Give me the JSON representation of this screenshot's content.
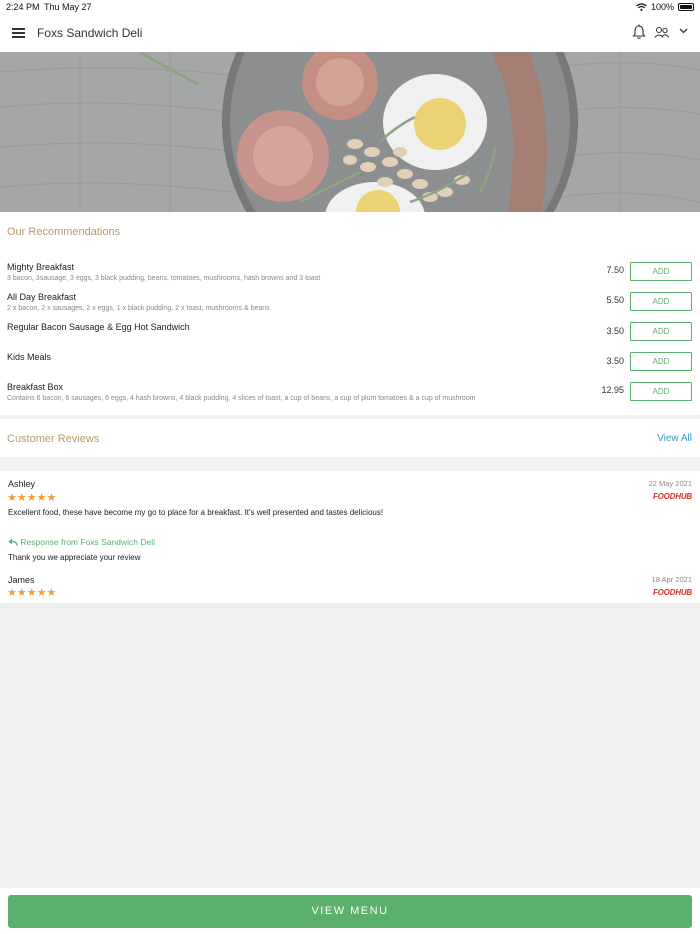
{
  "status_bar": {
    "time": "2:24 PM",
    "date": "Thu May 27",
    "battery": "100%"
  },
  "header": {
    "title": "Foxs Sandwich Deli"
  },
  "recommendations": {
    "title": "Our Recommendations",
    "add_label": "ADD",
    "items": [
      {
        "name": "Mighty Breakfast",
        "desc": "3 bacon, 3sausage, 3 eggs, 3 black pudding, beans, tomatoes, mushrooms, hash browns and 3 toast",
        "price": "7.50"
      },
      {
        "name": "All Day Breakfast",
        "desc": "2 x bacon, 2 x sausages, 2 x eggs, 1 x black pudding, 2 x toast, mushrooms & beans",
        "price": "5.50"
      },
      {
        "name": "Regular Bacon Sausage & Egg Hot Sandwich",
        "desc": "",
        "price": "3.50"
      },
      {
        "name": "Kids Meals",
        "desc": "",
        "price": "3.50"
      },
      {
        "name": "Breakfast Box",
        "desc": "Contains 6 bacon, 6 sausages, 6 eggs, 4 hash browns, 4 black pudding, 4 slices of toast, a cup of beans, a cup of plum tomatoes & a cup of mushroom",
        "price": "12.95"
      }
    ]
  },
  "reviews": {
    "title": "Customer Reviews",
    "view_all": "View All",
    "items": [
      {
        "name": "Ashley",
        "stars": "★★★★★",
        "rating": 5,
        "date": "22 May 2021",
        "source": "FOODHUB",
        "text": "Excellent food, these have become my go to place for a breakfast. It's well presented and tastes delicious!",
        "response_label": "Response from Foxs Sandwich Deli",
        "response": "Thank you we appreciate your review"
      },
      {
        "name": "James",
        "stars": "★★★★★",
        "rating": 5,
        "date": "18 Apr 2021",
        "source": "FOODHUB"
      }
    ]
  },
  "footer": {
    "view_menu": "VIEW MENU"
  },
  "colors": {
    "accent_green": "#5bb06e",
    "section_title": "#b79b6a",
    "link_blue": "#2f9ec9",
    "star_orange": "#f39c34",
    "foodhub_red": "#d93025"
  },
  "icons": [
    "menu-icon",
    "bell-icon",
    "profile-icon",
    "chevron-down-icon",
    "reply-icon",
    "wifi-icon",
    "battery-icon"
  ]
}
